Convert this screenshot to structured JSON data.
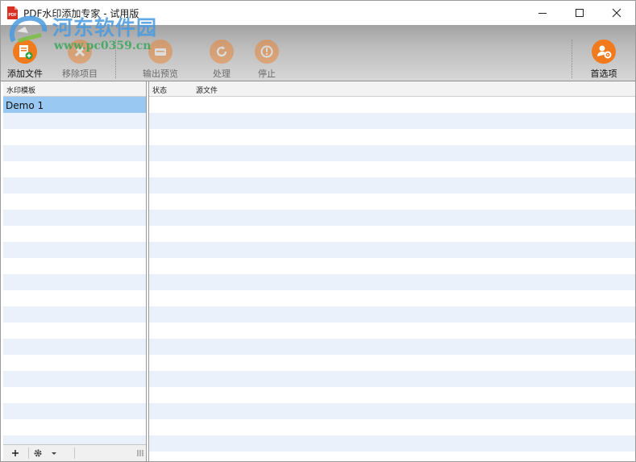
{
  "window": {
    "title": "PDF水印添加专家 - 试用版"
  },
  "watermark": {
    "site_name": "河东软件园",
    "url": "www.pc0359.cn"
  },
  "toolbar": {
    "buttons": [
      {
        "label": "添加文件",
        "icon": "add-file-icon",
        "enabled": true
      },
      {
        "label": "移除项目",
        "icon": "remove-icon",
        "enabled": false
      },
      {
        "label": "输出预览",
        "icon": "preview-icon",
        "enabled": false
      },
      {
        "label": "处理",
        "icon": "process-icon",
        "enabled": false
      },
      {
        "label": "停止",
        "icon": "stop-icon",
        "enabled": false
      },
      {
        "label": "首选项",
        "icon": "preferences-icon",
        "enabled": true
      }
    ]
  },
  "templates_panel": {
    "header": "水印模板",
    "items": [
      "Demo 1"
    ],
    "selected": "Demo 1"
  },
  "files_panel": {
    "columns": [
      "状态",
      "源文件"
    ],
    "rows": []
  },
  "colors": {
    "accent_orange": "#f07a1c",
    "selection_blue": "#99c9f3",
    "stripe": "#ebf1fb"
  }
}
